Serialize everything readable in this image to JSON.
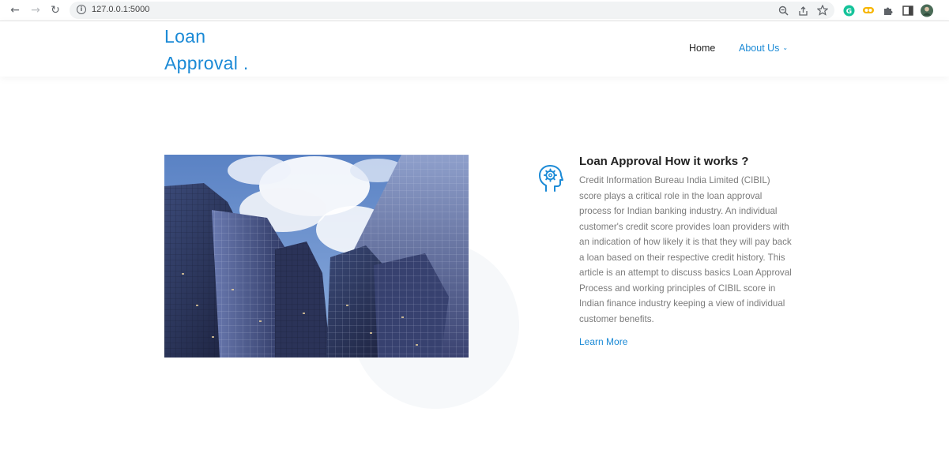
{
  "browser": {
    "url": "127.0.0.1:5000",
    "back_icon": "arrow-left-icon",
    "forward_icon": "arrow-right-icon",
    "reload_icon": "reload-icon"
  },
  "site": {
    "logo_line1": "Loan",
    "logo_line2": "Approval .",
    "nav": {
      "home": "Home",
      "about": "About Us"
    },
    "accent_color": "#1b8ad6"
  },
  "feature": {
    "title": "Loan Approval How it works ?",
    "text": "Credit Information Bureau India Limited (CIBIL) score plays a critical role in the loan approval process for Indian banking industry. An individual customer's credit score provides loan providers with an indication of how likely it is that they will pay back a loan based on their respective credit history. This article is an attempt to discuss basics Loan Approval Process and working principles of CIBIL score in Indian finance industry keeping a view of individual customer benefits.",
    "link": "Learn More",
    "icon": "head-gear-icon"
  },
  "image": {
    "subject": "skyscrapers-photo"
  }
}
